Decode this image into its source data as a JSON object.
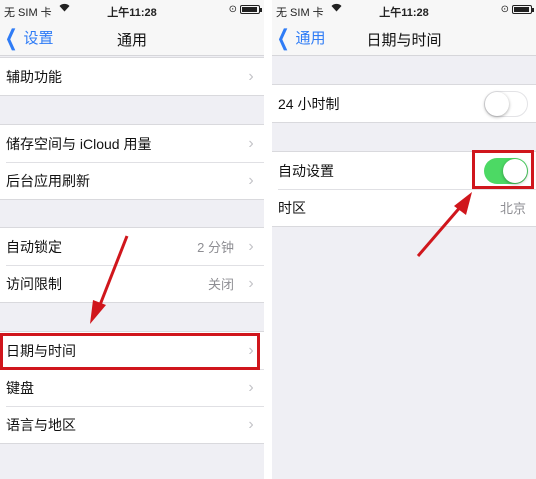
{
  "left": {
    "status": {
      "carrier": "无 SIM 卡",
      "time": "上午11:28"
    },
    "nav": {
      "back_label": "设置",
      "title": "通用"
    },
    "groups": [
      [
        {
          "label": "辅助功能"
        }
      ],
      [
        {
          "label": "储存空间与 iCloud 用量"
        },
        {
          "label": "后台应用刷新"
        }
      ],
      [
        {
          "label": "自动锁定",
          "value": "2 分钟"
        },
        {
          "label": "访问限制",
          "value": "关闭"
        }
      ],
      [
        {
          "label": "日期与时间"
        },
        {
          "label": "键盘"
        },
        {
          "label": "语言与地区"
        }
      ]
    ]
  },
  "right": {
    "status": {
      "carrier": "无 SIM 卡",
      "time": "上午11:28"
    },
    "nav": {
      "back_label": "通用",
      "title": "日期与时间"
    },
    "hour24": {
      "label": "24 小时制",
      "on": false
    },
    "auto_set": {
      "label": "自动设置",
      "on": true
    },
    "timezone": {
      "label": "时区",
      "value": "北京"
    }
  },
  "colors": {
    "accent": "#2f7cf6",
    "toggle_on": "#4cd964",
    "highlight": "#d0161c"
  }
}
